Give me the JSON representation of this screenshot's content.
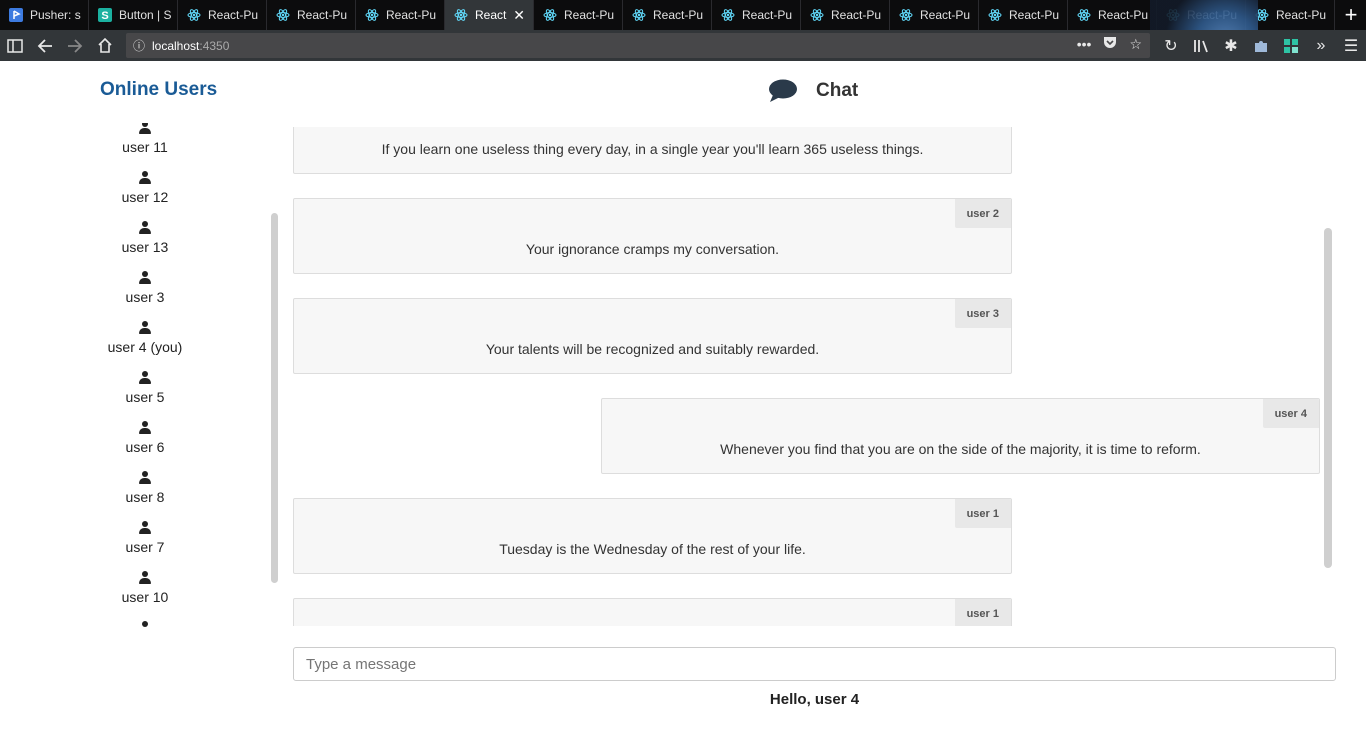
{
  "browser": {
    "tabs": [
      {
        "label": "Pusher: s",
        "icon": "pusher-icon"
      },
      {
        "label": "Button | S",
        "icon": "s-icon"
      },
      {
        "label": "React-Pu",
        "icon": "react-icon"
      },
      {
        "label": "React-Pu",
        "icon": "react-icon"
      },
      {
        "label": "React-Pu",
        "icon": "react-icon"
      },
      {
        "label": "React",
        "icon": "react-icon",
        "active": true
      },
      {
        "label": "React-Pu",
        "icon": "react-icon"
      },
      {
        "label": "React-Pu",
        "icon": "react-icon"
      },
      {
        "label": "React-Pu",
        "icon": "react-icon"
      },
      {
        "label": "React-Pu",
        "icon": "react-icon"
      },
      {
        "label": "React-Pu",
        "icon": "react-icon"
      },
      {
        "label": "React-Pu",
        "icon": "react-icon"
      },
      {
        "label": "React-Pu",
        "icon": "react-icon"
      },
      {
        "label": "React-Pu",
        "icon": "react-icon"
      },
      {
        "label": "React-Pu",
        "icon": "react-icon"
      }
    ],
    "url": {
      "host": "localhost",
      "port": ":4350"
    }
  },
  "sidebar": {
    "title": "Online Users",
    "users": [
      "user 11",
      "user 12",
      "user 13",
      "user 3",
      "user 4 (you)",
      "user 5",
      "user 6",
      "user 8",
      "user 7",
      "user 10"
    ]
  },
  "chat": {
    "title": "Chat",
    "messages": [
      {
        "author": "",
        "text": "If you learn one useless thing every day, in a single year you'll learn 365 useless things.",
        "side": "left"
      },
      {
        "author": "user 2",
        "text": "Your ignorance cramps my conversation.",
        "side": "left"
      },
      {
        "author": "user 3",
        "text": "Your talents will be recognized and suitably rewarded.",
        "side": "left"
      },
      {
        "author": "user 4",
        "text": "Whenever you find that you are on the side of the majority, it is time to reform.",
        "side": "right"
      },
      {
        "author": "user 1",
        "text": "Tuesday is the Wednesday of the rest of your life.",
        "side": "left"
      },
      {
        "author": "user 1",
        "text": "",
        "side": "left"
      }
    ],
    "composer_placeholder": "Type a message",
    "greeting": "Hello, user 4"
  },
  "colors": {
    "accent": "#1a5b96",
    "message_bg": "#f7f7f7",
    "author_bg": "#e8e8e8"
  }
}
